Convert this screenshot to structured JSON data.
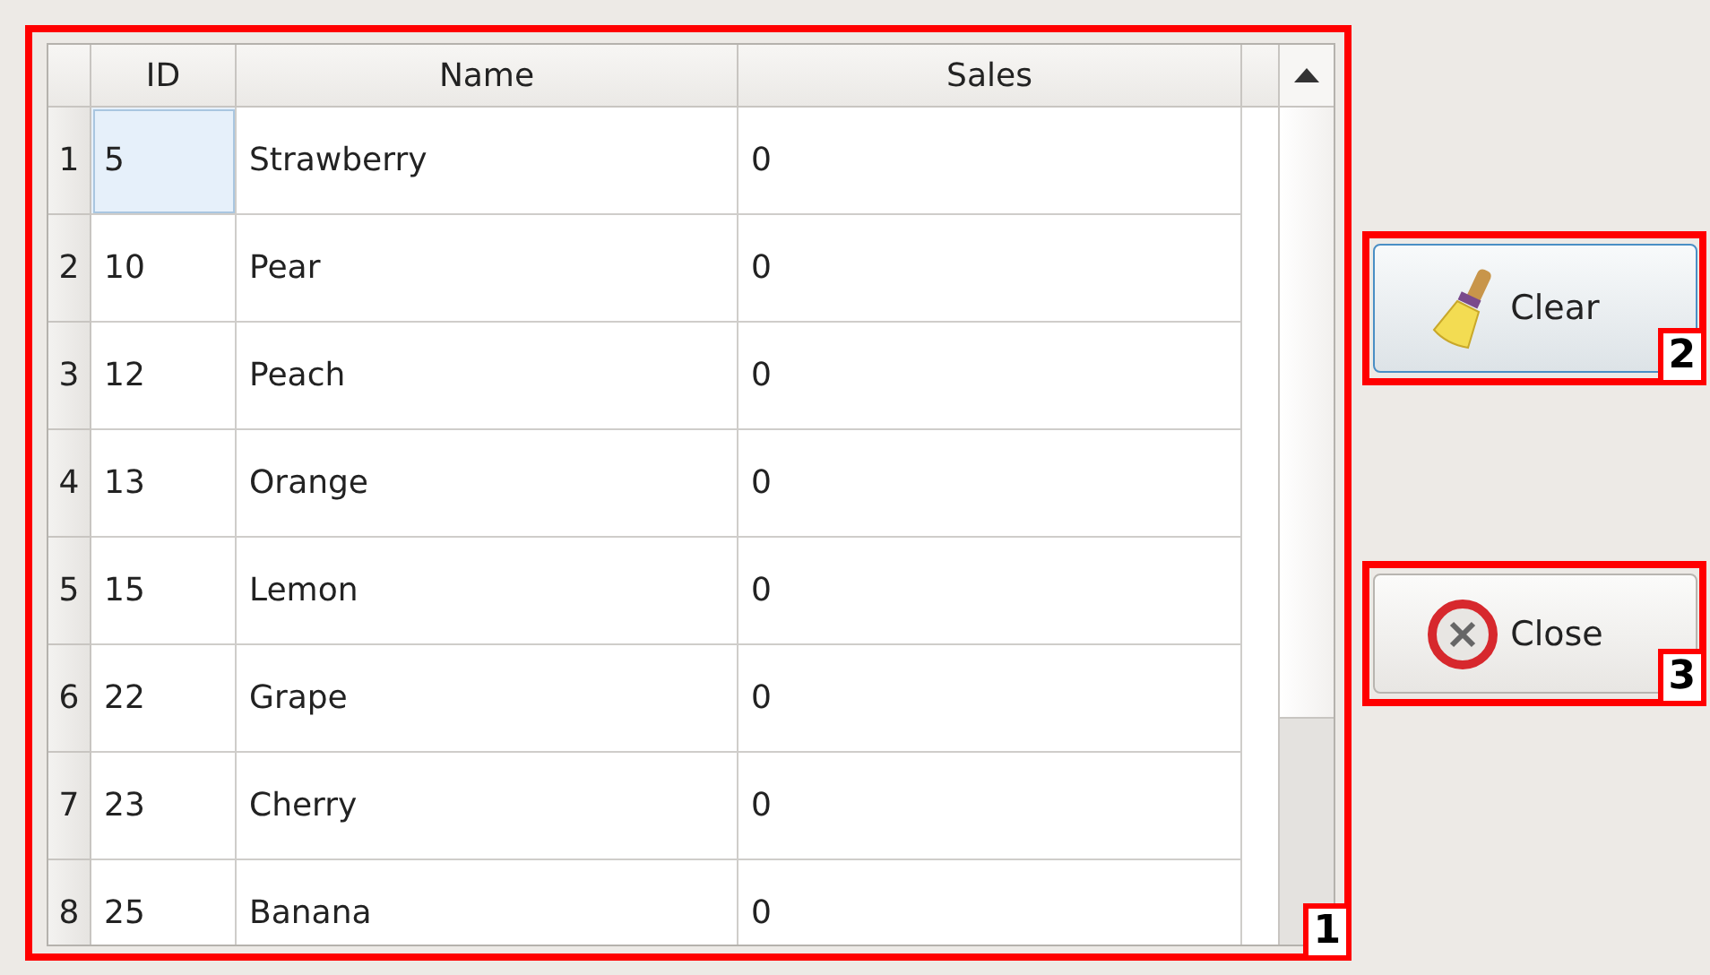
{
  "table": {
    "columns": [
      {
        "label": "ID"
      },
      {
        "label": "Name"
      },
      {
        "label": "Sales"
      }
    ],
    "rows": [
      {
        "number": "1",
        "id": "5",
        "name": "Strawberry",
        "sales": "0",
        "selected": true
      },
      {
        "number": "2",
        "id": "10",
        "name": "Pear",
        "sales": "0",
        "selected": false
      },
      {
        "number": "3",
        "id": "12",
        "name": "Peach",
        "sales": "0",
        "selected": false
      },
      {
        "number": "4",
        "id": "13",
        "name": "Orange",
        "sales": "0",
        "selected": false
      },
      {
        "number": "5",
        "id": "15",
        "name": "Lemon",
        "sales": "0",
        "selected": false
      },
      {
        "number": "6",
        "id": "22",
        "name": "Grape",
        "sales": "0",
        "selected": false
      },
      {
        "number": "7",
        "id": "23",
        "name": "Cherry",
        "sales": "0",
        "selected": false
      },
      {
        "number": "8",
        "id": "25",
        "name": "Banana",
        "sales": "0",
        "selected": false
      }
    ],
    "callout": "1"
  },
  "buttons": [
    {
      "kind": "clear",
      "label": "Clear",
      "callout": "2"
    },
    {
      "kind": "close",
      "label": "Close",
      "callout": "3"
    }
  ]
}
